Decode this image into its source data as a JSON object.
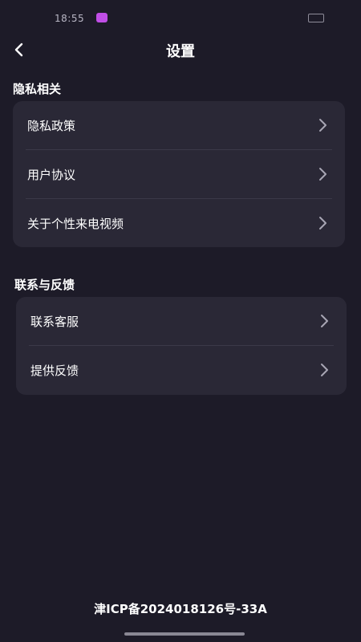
{
  "status_bar": {
    "time": "18:55",
    "icons": [
      "nfc-icon",
      "vibrate-icon",
      "bluetooth-icon",
      "hd-icon",
      "wifi-icon",
      "signal-icon",
      "battery-icon"
    ]
  },
  "header": {
    "title": "设置",
    "back_icon": "chevron-left-icon"
  },
  "sections": [
    {
      "title": "隐私相关",
      "items": [
        {
          "label": "隐私政策"
        },
        {
          "label": "用户协议"
        },
        {
          "label": "关于个性来电视频"
        }
      ]
    },
    {
      "title": "联系与反馈",
      "items": [
        {
          "label": "联系客服"
        },
        {
          "label": "提供反馈"
        }
      ]
    }
  ],
  "footer": {
    "icp": "津ICP备2024018126号-33A"
  },
  "colors": {
    "background": "#1d1b28",
    "card": "#2a2836",
    "text": "#ffffff",
    "chevron": "#a8a6b4"
  }
}
